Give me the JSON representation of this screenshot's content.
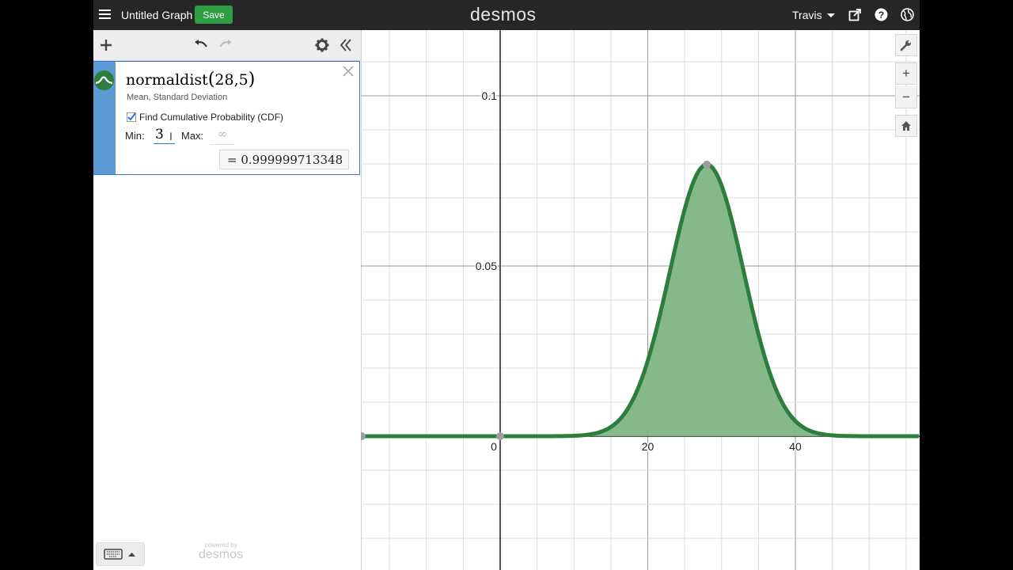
{
  "header": {
    "title": "Untitled Graph",
    "save_label": "Save",
    "logo": "desmos",
    "user": "Travis"
  },
  "expression": {
    "formula_name": "normaldist",
    "formula_args": "28,5",
    "params_note": "Mean, Standard Deviation",
    "cdf_label": "Find Cumulative Probability (CDF)",
    "cdf_checked": true,
    "min_label": "Min:",
    "min_value": "3",
    "max_label": "Max:",
    "max_placeholder": "∞",
    "result": "= 0.999999713348"
  },
  "footer": {
    "powered_by": "powered by",
    "brand": "desmos"
  },
  "graph": {
    "y_ticks": [
      "0.1",
      "0.05"
    ],
    "x_ticks": [
      "0",
      "20",
      "40"
    ],
    "curve_color": "#2d7d3e",
    "fill_color": "#7fb583",
    "mean": 28,
    "sd": 5,
    "shade_min": 3
  },
  "controls": {
    "zoom_in": "+",
    "zoom_out": "−"
  }
}
